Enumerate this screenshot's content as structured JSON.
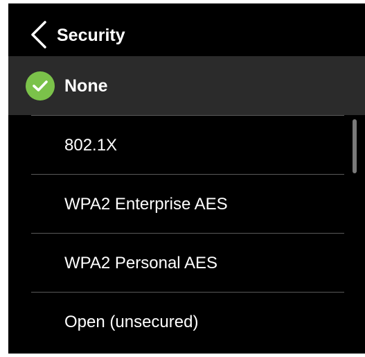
{
  "header": {
    "title": "Security",
    "back_icon": "chevron-left-icon"
  },
  "selected": {
    "label": "None",
    "icon": "check-circle-icon",
    "icon_color": "#7bc24a"
  },
  "options": [
    {
      "label": "802.1X"
    },
    {
      "label": "WPA2 Enterprise AES"
    },
    {
      "label": "WPA2 Personal AES"
    },
    {
      "label": "Open (unsecured)"
    }
  ],
  "colors": {
    "background": "#000000",
    "selected_row": "#2b2b2b",
    "text": "#ffffff",
    "divider": "#5a5a5a",
    "accent": "#7bc24a"
  }
}
